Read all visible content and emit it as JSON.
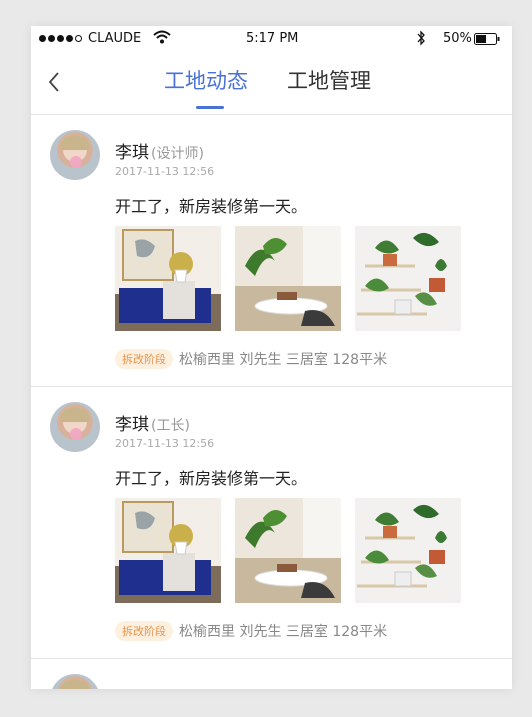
{
  "status_bar": {
    "carrier": "CLAUDE",
    "time": "5:17 PM",
    "battery": "50%",
    "signal_dots_filled": 4,
    "signal_dots_total": 5,
    "battery_level": 0.5
  },
  "nav": {
    "back_icon": "chevron-left-icon",
    "tabs": [
      {
        "label": "工地动态",
        "active": true
      },
      {
        "label": "工地管理",
        "active": false
      }
    ],
    "accent_color": "#4a72d6"
  },
  "posts": [
    {
      "name": "李琪",
      "role": "(设计师)",
      "date": "2017-11-13 12:56",
      "content": "开工了，新房装修第一天。",
      "tag": "拆改阶段",
      "meta": "松榆西里 刘先生 三居室 128平米"
    },
    {
      "name": "李琪",
      "role": "(工长)",
      "date": "2017-11-13 12:56",
      "content": "开工了，新房装修第一天。",
      "tag": "拆改阶段",
      "meta": "松榆西里 刘先生 三居室 128平米"
    }
  ]
}
